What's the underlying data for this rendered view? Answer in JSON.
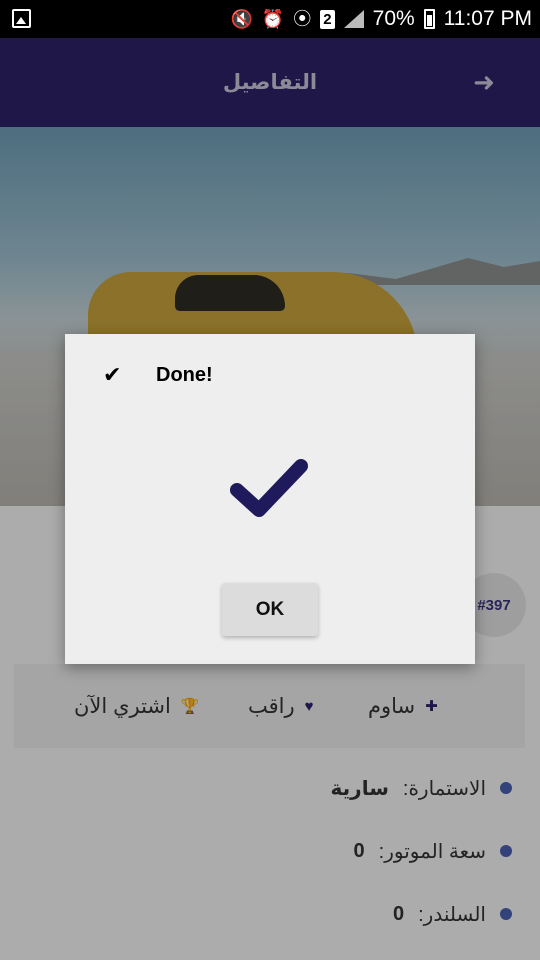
{
  "status_bar": {
    "battery": "70%",
    "time": "11:07 PM",
    "sim_number": "2",
    "icons": [
      "image-icon",
      "mute-icon",
      "alarm-icon",
      "hotspot-icon",
      "signal-icon",
      "battery-icon"
    ]
  },
  "app_bar": {
    "title": "التفاصيل",
    "back_icon": "back-arrow-icon"
  },
  "item": {
    "id_badge": "#397"
  },
  "actions": [
    {
      "label": "ساوم",
      "icon": "plus-icon"
    },
    {
      "label": "راقب",
      "icon": "heart-icon"
    },
    {
      "label": "اشتري الآن",
      "icon": "trophy-icon"
    }
  ],
  "details": [
    {
      "label": "الاستمارة:",
      "value": "سارية"
    },
    {
      "label": "سعة الموتور:",
      "value": "0"
    },
    {
      "label": "السلندر:",
      "value": "0"
    }
  ],
  "dialog": {
    "title": "Done!",
    "button_label": "OK",
    "check_color": "#1f1a5c"
  },
  "colors": {
    "app_bar": "#2b2166",
    "accent": "#2b2166",
    "bullet": "#4a5fb0"
  }
}
